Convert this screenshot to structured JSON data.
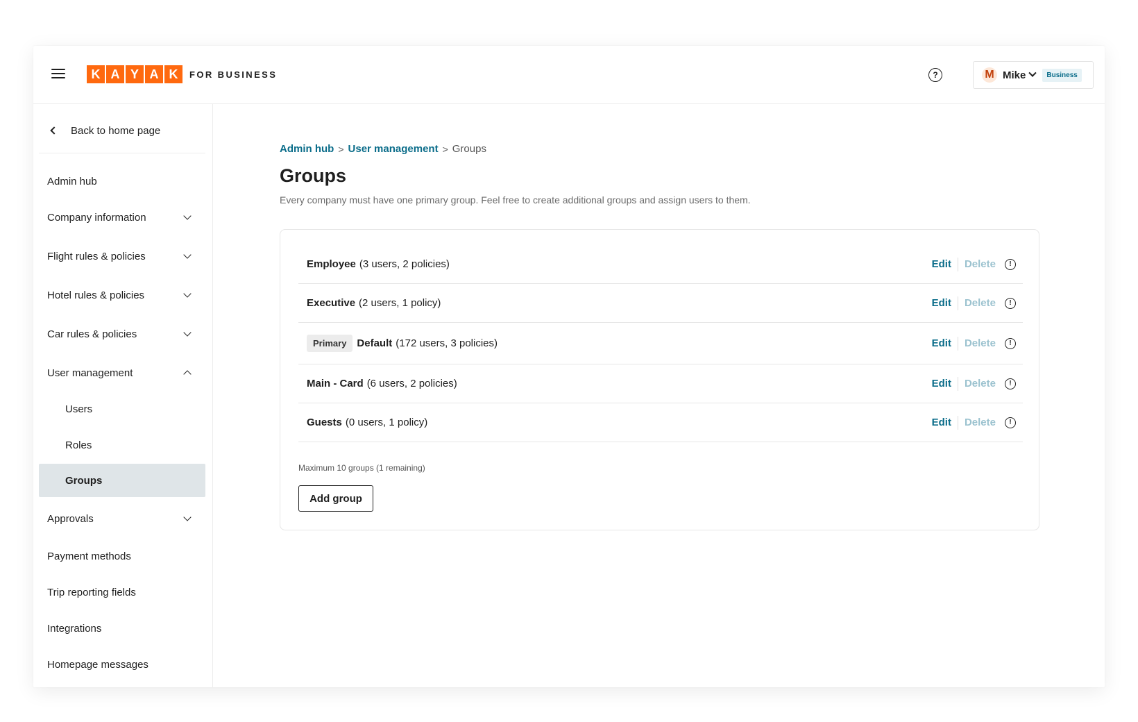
{
  "header": {
    "logo_letters": [
      "K",
      "A",
      "Y",
      "A",
      "K"
    ],
    "logo_subtitle": "FOR BUSINESS",
    "help_glyph": "?",
    "account": {
      "initial": "M",
      "name": "Mike",
      "badge": "Business"
    }
  },
  "sidebar": {
    "back_label": "Back to home page",
    "items": [
      {
        "label": "Admin hub"
      },
      {
        "label": "Company information"
      },
      {
        "label": "Flight rules & policies"
      },
      {
        "label": "Hotel rules & policies"
      },
      {
        "label": "Car rules & policies"
      },
      {
        "label": "User management"
      },
      {
        "label": "Users"
      },
      {
        "label": "Roles"
      },
      {
        "label": "Groups"
      },
      {
        "label": "Approvals"
      },
      {
        "label": "Payment methods"
      },
      {
        "label": "Trip reporting fields"
      },
      {
        "label": "Integrations"
      },
      {
        "label": "Homepage messages"
      }
    ]
  },
  "breadcrumb": {
    "items": [
      "Admin hub",
      "User management"
    ],
    "current": "Groups",
    "separator": ">"
  },
  "page": {
    "title": "Groups",
    "description": "Every company must have one primary group. Feel free to create additional groups and assign users to them."
  },
  "groups": {
    "rows": [
      {
        "name": "Employee",
        "count": "(3 users, 2 policies)",
        "tag": ""
      },
      {
        "name": "Executive",
        "count": "(2 users, 1 policy)",
        "tag": ""
      },
      {
        "name": "Default",
        "count": "(172 users, 3 policies)",
        "tag": "Primary"
      },
      {
        "name": "Main - Card",
        "count": "(6 users, 2 policies)",
        "tag": ""
      },
      {
        "name": "Guests",
        "count": "(0 users, 1 policy)",
        "tag": ""
      }
    ],
    "edit_label": "Edit",
    "delete_label": "Delete",
    "info_glyph": "!",
    "max_note": "Maximum 10 groups (1 remaining)",
    "add_label": "Add group"
  },
  "colors": {
    "brand": "#ff690f",
    "link": "#0b6d8a",
    "disabled_link": "#9bc2cf",
    "active_nav": "#dfe5e8"
  }
}
